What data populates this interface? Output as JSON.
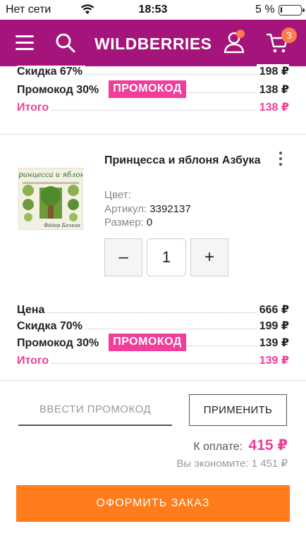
{
  "status_bar": {
    "carrier": "Нет сети",
    "time": "18:53",
    "battery_percent": "5 %"
  },
  "header": {
    "logo": "WILDBERRIES",
    "cart_count": "3",
    "brand_color": "#a4147a",
    "badge_color": "#ff7a4d"
  },
  "item1_prices": {
    "discount_label": "Скидка 67%",
    "discount_value": "198 ₽",
    "promo_label": "Промокод 30%",
    "promo_badge": "ПРОМОКОД",
    "promo_value": "138 ₽",
    "total_label": "Итого",
    "total_value": "138 ₽"
  },
  "product": {
    "title": "Принцесса и яблоня Азбука",
    "color_label": "Цвет:",
    "color_value": "",
    "article_label": "Артикул:",
    "article_value": "3392137",
    "size_label": "Размер:",
    "size_value": "0",
    "quantity": "1",
    "minus": "–",
    "plus": "+",
    "image_title": "Принцесса и яблоня",
    "image_author": "Фёдор Бачков"
  },
  "item2_prices": {
    "price_label": "Цена",
    "price_value": "666 ₽",
    "discount_label": "Скидка 70%",
    "discount_value": "199 ₽",
    "promo_label": "Промокод 30%",
    "promo_badge": "ПРОМОКОД",
    "promo_value": "139 ₽",
    "total_label": "Итого",
    "total_value": "139 ₽"
  },
  "promo_form": {
    "placeholder": "ВВЕСТИ ПРОМОКОД",
    "apply_label": "ПРИМЕНИТЬ"
  },
  "summary": {
    "to_pay_label": "К оплате:",
    "to_pay_value": "415 ₽",
    "savings_text": "Вы экономите: 1 451 ₽"
  },
  "checkout": {
    "label": "ОФОРМИТЬ ЗАКАЗ",
    "color": "#ff7b1c"
  },
  "accent_color": "#f03e9a"
}
